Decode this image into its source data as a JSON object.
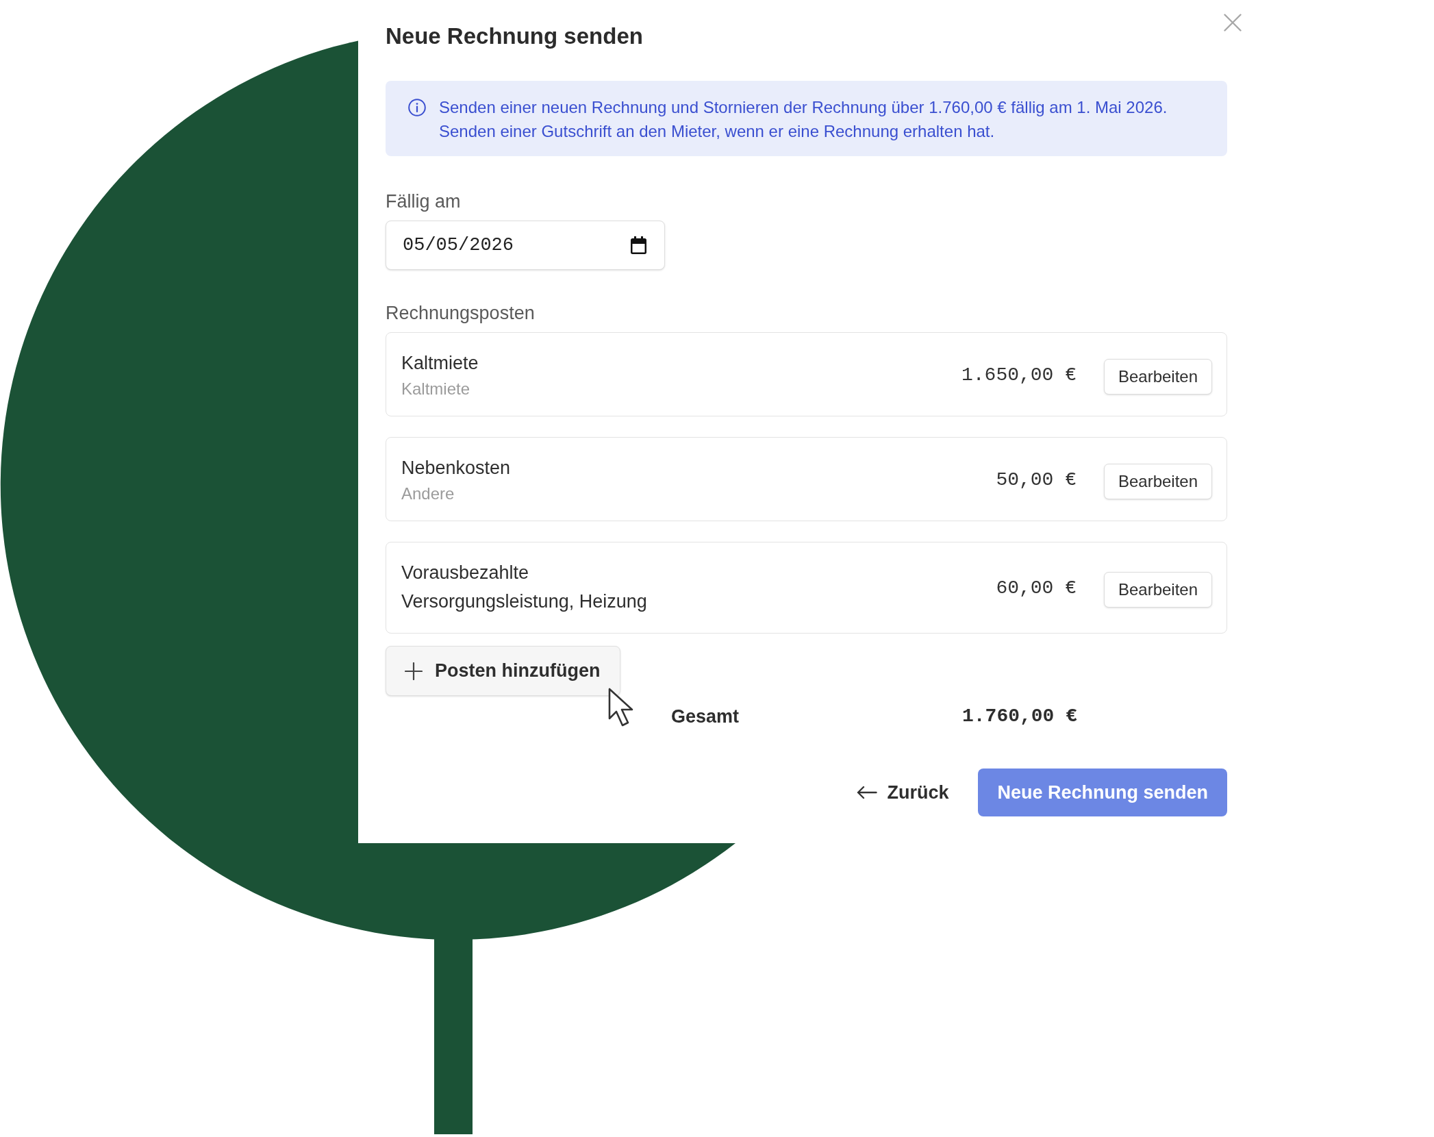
{
  "dialog": {
    "title": "Neue Rechnung senden"
  },
  "info_banner": {
    "text": "Senden einer neuen Rechnung und Stornieren der Rechnung über 1.760,00 € fällig am 1. Mai 2026. Senden einer Gutschrift an den Mieter, wenn er eine Rechnung erhalten hat."
  },
  "due_date": {
    "label": "Fällig am",
    "value": "05/05/2026"
  },
  "line_items": {
    "label": "Rechnungsposten",
    "items": [
      {
        "name": "Kaltmiete",
        "category": "Kaltmiete",
        "amount": "1.650,00 €",
        "edit_button": "Bearbeiten"
      },
      {
        "name": "Nebenkosten",
        "category": "Andere",
        "amount": "50,00 €",
        "edit_button": "Bearbeiten"
      },
      {
        "name": "Vorausbezahlte Versorgungsleistung, Heizung",
        "amount": "60,00 €",
        "edit_button": "Bearbeiten"
      }
    ]
  },
  "add_item_button": {
    "label": "Posten hinzufügen"
  },
  "total": {
    "label": "Gesamt",
    "amount": "1.760,00 €"
  },
  "footer": {
    "back_button": {
      "label": "Zurück"
    },
    "send_button": {
      "label": "Neue Rechnung senden"
    }
  }
}
